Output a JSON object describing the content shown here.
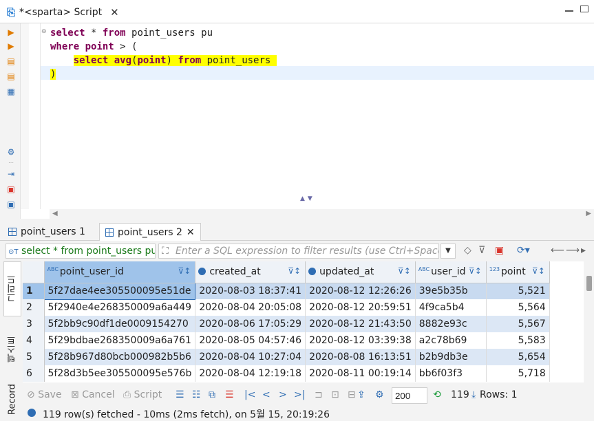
{
  "editor_tab": {
    "icon": "sql-script-icon",
    "title": "*<sparta> Script"
  },
  "code_lines": [
    [
      {
        "t": "select",
        "k": "kw"
      },
      {
        "t": " * ",
        "k": ""
      },
      {
        "t": "from",
        "k": "kw"
      },
      {
        "t": " point_users pu",
        "k": ""
      }
    ],
    [
      {
        "t": "where",
        "k": "kw"
      },
      {
        "t": " ",
        "k": ""
      },
      {
        "t": "point",
        "k": "kw"
      },
      {
        "t": " > (",
        "k": ""
      }
    ],
    [
      {
        "t": "    ",
        "k": ""
      },
      {
        "t": "select",
        "k": "kw hl"
      },
      {
        "t": " ",
        "k": "hl"
      },
      {
        "t": "avg",
        "k": "kw hl"
      },
      {
        "t": "(",
        "k": "hl"
      },
      {
        "t": "point",
        "k": "kw hl"
      },
      {
        "t": ") ",
        "k": "hl"
      },
      {
        "t": "from",
        "k": "kw hl"
      },
      {
        "t": " point_users ",
        "k": "hl"
      }
    ],
    [
      {
        "t": ")",
        "k": "hl"
      }
    ]
  ],
  "result_tabs": [
    {
      "label": "point_users 1",
      "active": false
    },
    {
      "label": "point_users 2",
      "active": true
    }
  ],
  "filter": {
    "query": "select * from point_users pu",
    "placeholder": "Enter a SQL expression to filter results (use Ctrl+Space)"
  },
  "side_tabs": {
    "grid": "그리드",
    "text": "텍스트",
    "record": "Record"
  },
  "table": {
    "columns": [
      {
        "label": "point_user_id",
        "type": "ABC"
      },
      {
        "label": "created_at",
        "type": "clock"
      },
      {
        "label": "updated_at",
        "type": "clock"
      },
      {
        "label": "user_id",
        "type": "ABC"
      },
      {
        "label": "point",
        "type": "123"
      }
    ],
    "rows": [
      [
        "1",
        "5f27dae4ee305500095e51de",
        "2020-08-03 18:37:41",
        "2020-08-12 12:26:26",
        "39e5b35b",
        "5,521"
      ],
      [
        "2",
        "5f2940e4e268350009a6a449",
        "2020-08-04 20:05:08",
        "2020-08-12 20:59:51",
        "4f9ca5b4",
        "5,564"
      ],
      [
        "3",
        "5f2bb9c90df1de0009154270",
        "2020-08-06 17:05:29",
        "2020-08-12 21:43:50",
        "8882e93c",
        "5,567"
      ],
      [
        "4",
        "5f29bdbae268350009a6a761",
        "2020-08-05 04:57:46",
        "2020-08-12 03:39:38",
        "a2c78b69",
        "5,583"
      ],
      [
        "5",
        "5f28b967d80bcb000982b5b6",
        "2020-08-04 10:27:04",
        "2020-08-08 16:13:51",
        "b2b9db3e",
        "5,654"
      ],
      [
        "6",
        "5f28d3b5ee305500095e576b",
        "2020-08-04 12:19:18",
        "2020-08-11 00:19:14",
        "bb6f03f3",
        "5,718"
      ]
    ]
  },
  "bottom": {
    "save": "Save",
    "cancel": "Cancel",
    "script": "Script",
    "fetch_size": "200",
    "fetched_count": "119",
    "rows_label": "Rows: 1"
  },
  "status": "119 row(s) fetched - 10ms (2ms fetch), on 5월 15, 20:19:26"
}
